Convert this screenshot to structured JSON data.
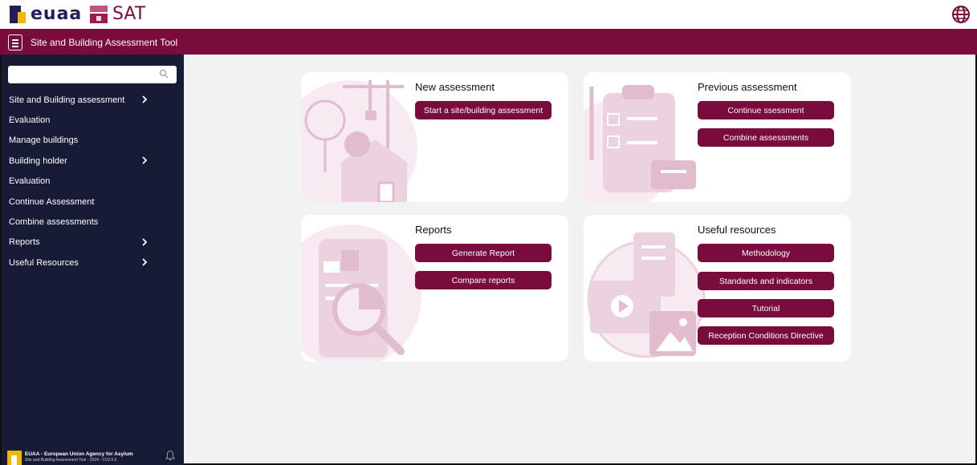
{
  "brand": {
    "logo_text": "euaa",
    "app_logo_text": "SAT"
  },
  "header": {
    "title": "Site and Building Assessment Tool",
    "globe_icon": "globe-icon",
    "menu_icon": "hamburger-menu-icon"
  },
  "colors": {
    "primary": "#7a0b3d",
    "sidebar": "#171b36",
    "illustration": "#e8c9d6",
    "background": "#f3f2f3"
  },
  "sidebar": {
    "search": {
      "value": "",
      "placeholder": "",
      "icon": "search-icon"
    },
    "items": [
      {
        "label": "Site and Building assessment",
        "has_submenu": true
      },
      {
        "label": "Evaluation",
        "has_submenu": false
      },
      {
        "label": "Manage buildings",
        "has_submenu": false
      },
      {
        "label": "Building holder",
        "has_submenu": true
      },
      {
        "label": "Evaluation",
        "has_submenu": false
      },
      {
        "label": "Continue Assessment",
        "has_submenu": false
      },
      {
        "label": "Combine assessments",
        "has_submenu": false
      },
      {
        "label": "Reports",
        "has_submenu": true
      },
      {
        "label": "Useful Resources",
        "has_submenu": true
      }
    ],
    "footer": {
      "org": "EUAA - European Union Agency for Asylum",
      "version": "Site and Building Assessment Tool - 2024 - CV2.0.6",
      "bell_icon": "bell-icon"
    }
  },
  "cards": {
    "new_assessment": {
      "title": "New assessment",
      "buttons": [
        "Start a site/building assessment"
      ]
    },
    "previous_assessment": {
      "title": "Previous assessment",
      "buttons": [
        "Continue ssessment",
        "Combine assessments"
      ]
    },
    "reports": {
      "title": "Reports",
      "buttons": [
        "Generate Report",
        "Compare reports"
      ]
    },
    "useful_resources": {
      "title": "Useful resources",
      "buttons": [
        "Methodology",
        "Standards and indicators",
        "Tutorial",
        "Reception Conditions Directive"
      ]
    }
  }
}
